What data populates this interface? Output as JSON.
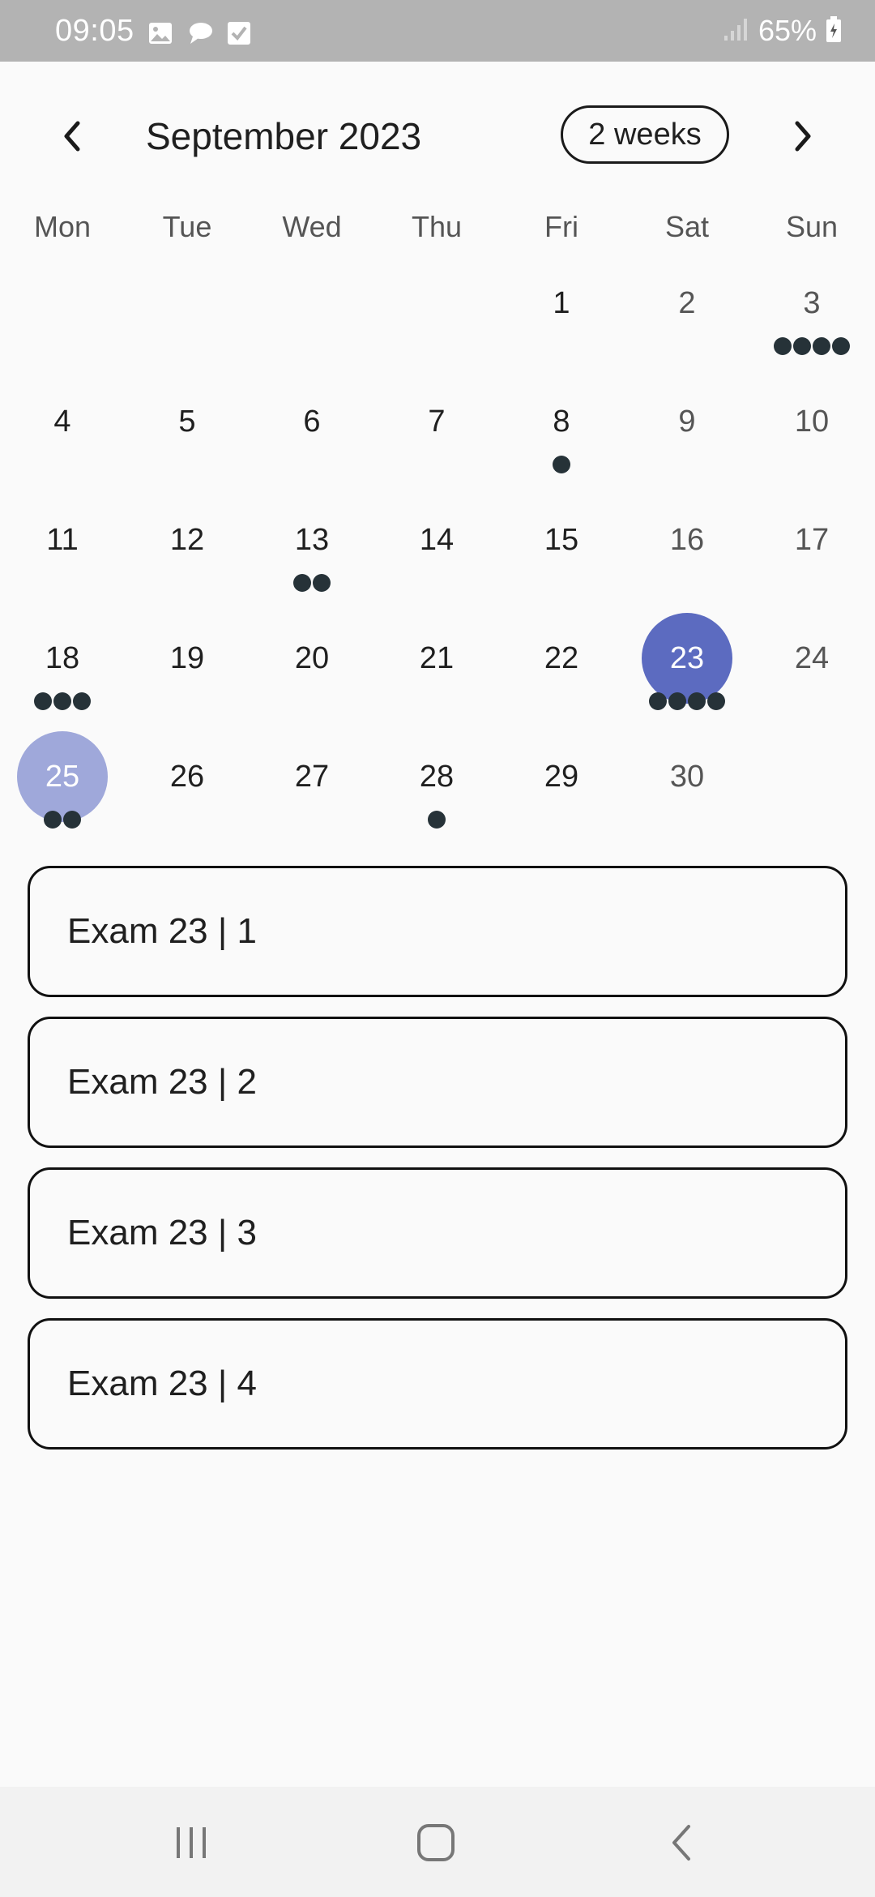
{
  "status_bar": {
    "time": "09:05",
    "battery_percent": "65%",
    "notification_icons": [
      "image-icon",
      "chat-icon",
      "checkbox-icon"
    ],
    "right_icons": [
      "signal-icon",
      "battery-icon"
    ]
  },
  "header": {
    "title": "September 2023",
    "format_button_label": "2 weeks",
    "prev_icon": "chevron-left-icon",
    "next_icon": "chevron-right-icon"
  },
  "days_of_week": [
    "Mon",
    "Tue",
    "Wed",
    "Thu",
    "Fri",
    "Sat",
    "Sun"
  ],
  "calendar": {
    "rows": [
      [
        {
          "day": "",
          "markers": 0
        },
        {
          "day": "",
          "markers": 0
        },
        {
          "day": "",
          "markers": 0
        },
        {
          "day": "",
          "markers": 0
        },
        {
          "day": "1",
          "markers": 0
        },
        {
          "day": "2",
          "markers": 0
        },
        {
          "day": "3",
          "markers": 4
        }
      ],
      [
        {
          "day": "4",
          "markers": 0
        },
        {
          "day": "5",
          "markers": 0
        },
        {
          "day": "6",
          "markers": 0
        },
        {
          "day": "7",
          "markers": 0
        },
        {
          "day": "8",
          "markers": 1
        },
        {
          "day": "9",
          "markers": 0
        },
        {
          "day": "10",
          "markers": 0
        }
      ],
      [
        {
          "day": "11",
          "markers": 0
        },
        {
          "day": "12",
          "markers": 0
        },
        {
          "day": "13",
          "markers": 2
        },
        {
          "day": "14",
          "markers": 0
        },
        {
          "day": "15",
          "markers": 0
        },
        {
          "day": "16",
          "markers": 0
        },
        {
          "day": "17",
          "markers": 0
        }
      ],
      [
        {
          "day": "18",
          "markers": 3
        },
        {
          "day": "19",
          "markers": 0
        },
        {
          "day": "20",
          "markers": 0
        },
        {
          "day": "21",
          "markers": 0
        },
        {
          "day": "22",
          "markers": 0
        },
        {
          "day": "23",
          "markers": 4,
          "state": "selected"
        },
        {
          "day": "24",
          "markers": 0
        }
      ],
      [
        {
          "day": "25",
          "markers": 2,
          "state": "today"
        },
        {
          "day": "26",
          "markers": 0
        },
        {
          "day": "27",
          "markers": 0
        },
        {
          "day": "28",
          "markers": 1
        },
        {
          "day": "29",
          "markers": 0
        },
        {
          "day": "30",
          "markers": 0
        },
        {
          "day": "",
          "markers": 0
        }
      ]
    ]
  },
  "events": [
    {
      "title": "Exam 23 | 1"
    },
    {
      "title": "Exam 23 | 2"
    },
    {
      "title": "Exam 23 | 3"
    },
    {
      "title": "Exam 23 | 4"
    }
  ],
  "nav_bar": {
    "buttons": [
      "recent-apps-icon",
      "home-icon",
      "back-icon"
    ]
  },
  "colors": {
    "status_bar_bg": "#b3b3b3",
    "background": "#fafafa",
    "selected_day": "#5c6bc0",
    "today_day": "#9fa8da",
    "marker": "#263238"
  }
}
